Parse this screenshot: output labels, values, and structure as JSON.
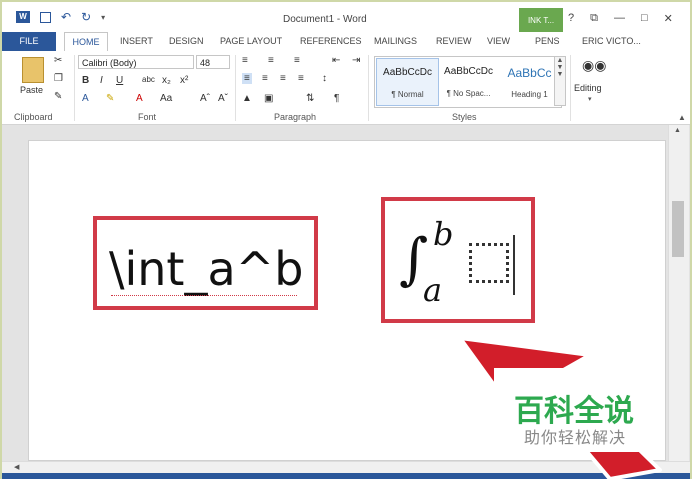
{
  "window": {
    "title": "Document1 - Word",
    "ink_tab_label": "INK T...",
    "help": "?",
    "restore": "⧉",
    "minimize": "—",
    "maximize": "□",
    "close": "✕"
  },
  "tabs": {
    "file": "FILE",
    "home": "HOME",
    "insert": "INSERT",
    "design": "DESIGN",
    "page_layout": "PAGE LAYOUT",
    "references": "REFERENCES",
    "mailings": "MAILINGS",
    "review": "REVIEW",
    "view": "VIEW",
    "pens": "PENS",
    "user": "ERIC VICTO..."
  },
  "ribbon": {
    "clipboard": {
      "paste": "Paste",
      "label": "Clipboard"
    },
    "font": {
      "family": "Calibri (Body)",
      "size": "48",
      "label": "Font"
    },
    "paragraph": {
      "label": "Paragraph"
    },
    "styles": {
      "label": "Styles",
      "items": [
        {
          "sample": "AaBbCcDc",
          "name": "¶ Normal"
        },
        {
          "sample": "AaBbCcDc",
          "name": "¶ No Spac..."
        },
        {
          "sample": "AaBbCc",
          "name": "Heading 1"
        }
      ]
    },
    "editing": {
      "label": "Editing"
    }
  },
  "document": {
    "linear_equation": "\\int_a^b",
    "integral_symbol": "∫",
    "upper_limit": "b",
    "lower_limit": "a"
  },
  "watermark": {
    "main": "百科全说",
    "sub": "助你轻松解决"
  },
  "colors": {
    "accent": "#2b579a",
    "highlight_box": "#d13a48",
    "ink_tab": "#6aa84f",
    "watermark_green": "#2da94f"
  }
}
